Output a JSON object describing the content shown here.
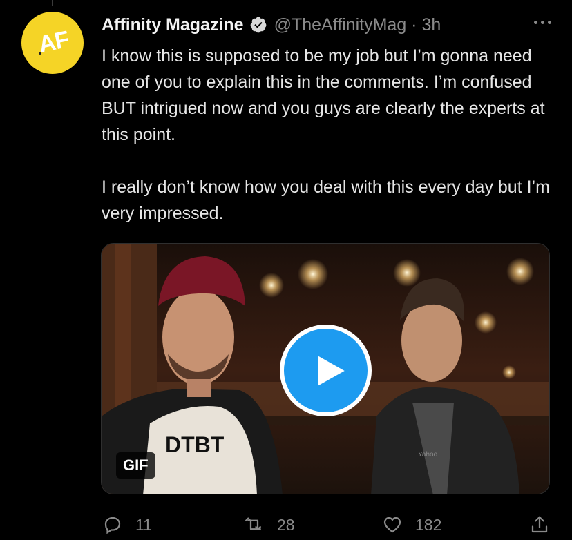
{
  "tweet": {
    "author_name": "Affinity Magazine",
    "handle_time": "@TheAffinityMag · 3h",
    "avatar_text": "AF",
    "paragraphs": [
      "I know this is supposed to be my job but I’m gonna need one of you to explain this in the comments. I’m confused BUT intrigued now and you guys are clearly the experts at this point.",
      "I really don’t know how you deal with this every day but I’m very impressed."
    ],
    "media": {
      "badge": "GIF",
      "shirt_text": "DTBT",
      "hoodie_text": "Yahoo"
    },
    "actions": {
      "replies": "11",
      "retweets": "28",
      "likes": "182"
    }
  },
  "colors": {
    "background": "#000000",
    "accent": "#1d9bf0",
    "avatar": "#f5d426",
    "muted": "#8a8a8a"
  },
  "icons": [
    "verified-icon",
    "more-icon",
    "play-icon",
    "reply-icon",
    "retweet-icon",
    "like-icon",
    "share-icon"
  ]
}
